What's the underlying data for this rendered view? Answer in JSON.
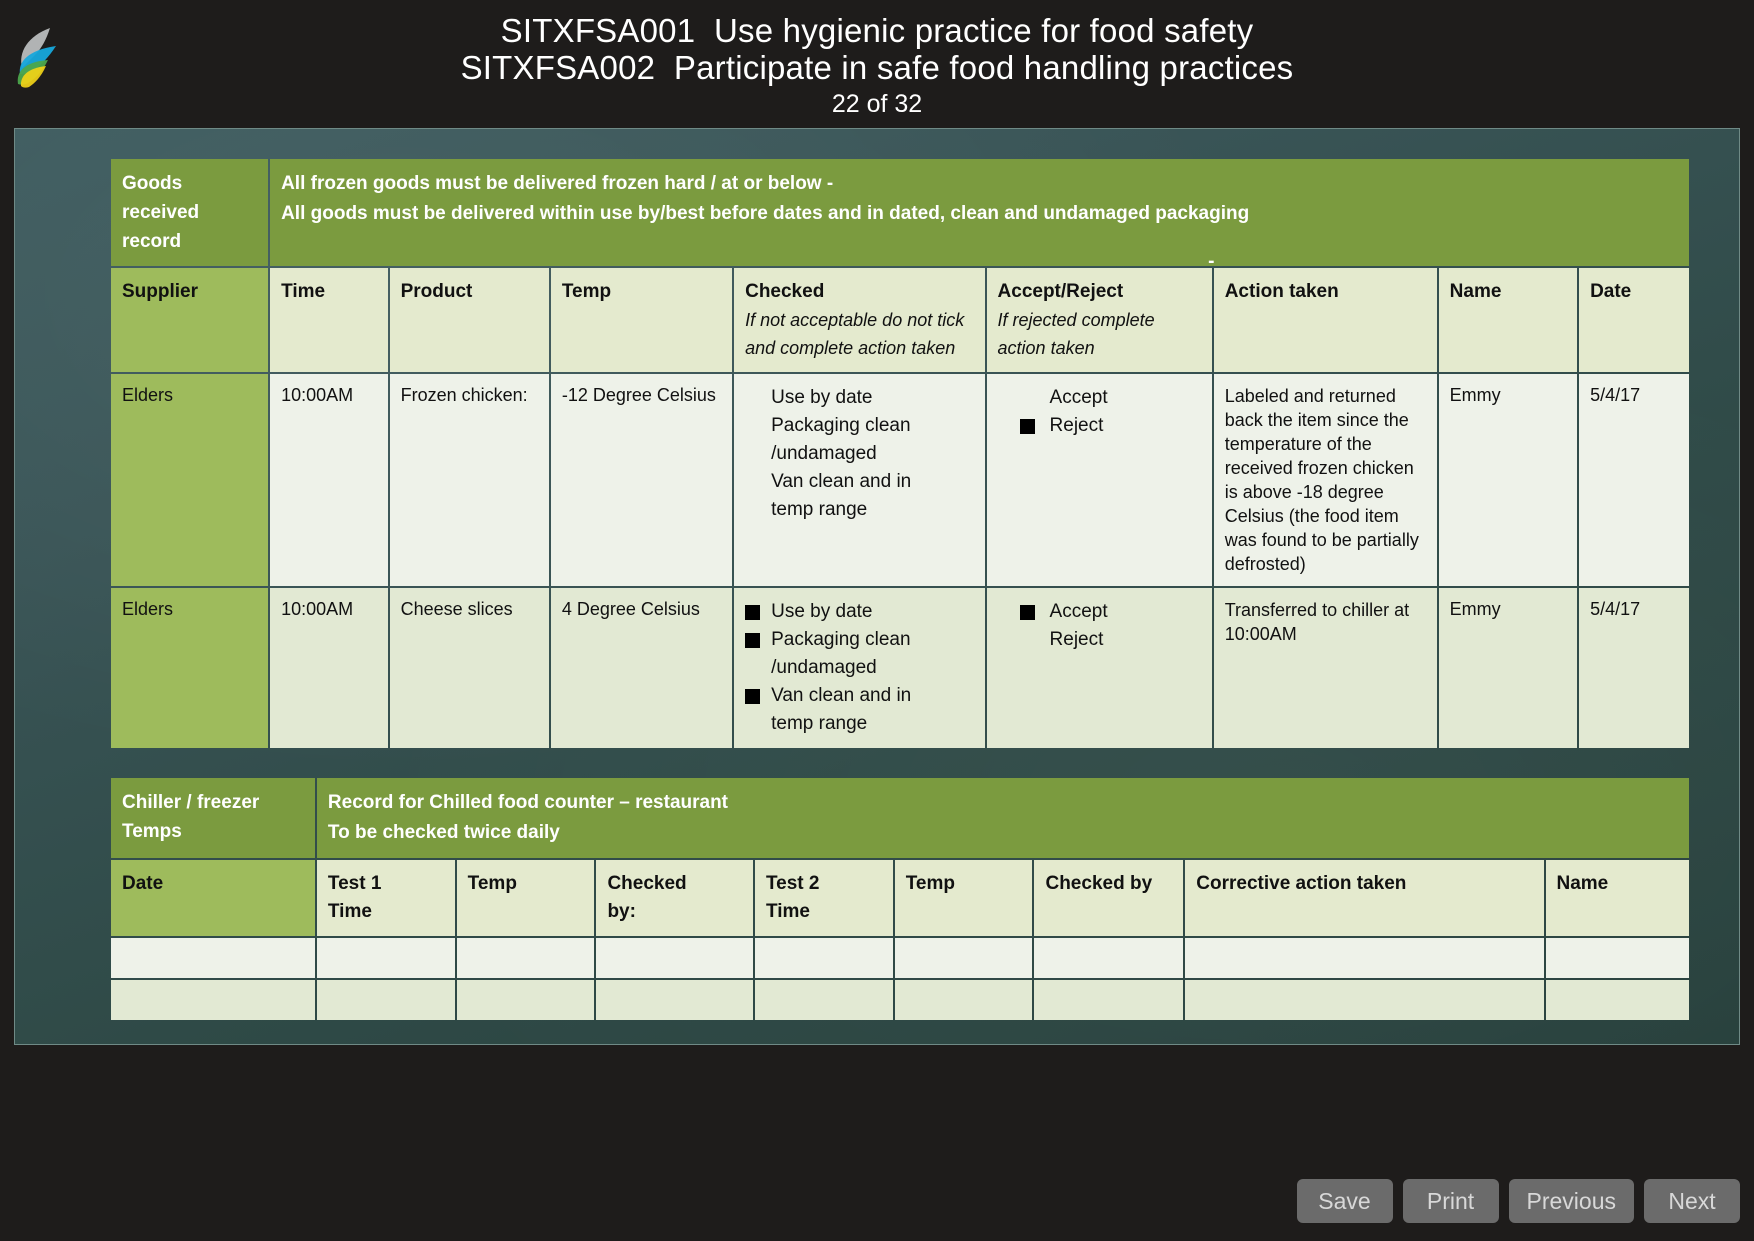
{
  "header": {
    "title_line1": "SITXFSA001  Use hygienic practice for food safety",
    "title_line2": "SITXFSA002  Participate in safe food handling practices",
    "slide_counter": "22 of 32",
    "logo_name": "company-feather-logo"
  },
  "goods_table": {
    "banner_label": "Goods\nreceived\nrecord",
    "banner_line1": "All frozen goods must be delivered frozen hard / at or below -",
    "banner_line2": "All goods must be delivered within use by/best before dates and in dated, clean and undamaged packaging",
    "banner_trailing_dash": "-",
    "columns": [
      {
        "main": "Supplier",
        "sub": ""
      },
      {
        "main": "Time",
        "sub": ""
      },
      {
        "main": "Product",
        "sub": ""
      },
      {
        "main": "Temp",
        "sub": ""
      },
      {
        "main": "Checked",
        "sub": "If not acceptable do not tick and complete action taken"
      },
      {
        "main": "Accept/Reject",
        "sub": "If rejected complete action taken"
      },
      {
        "main": "Action taken",
        "sub": ""
      },
      {
        "main": "Name",
        "sub": ""
      },
      {
        "main": "Date",
        "sub": ""
      }
    ],
    "rows": [
      {
        "supplier": "Elders",
        "time": "10:00AM",
        "product": "Frozen chicken:",
        "temp": "-12 Degree Celsius",
        "checked": [
          {
            "label": "Use by date",
            "ticked": false
          },
          {
            "label": "Packaging clean",
            "ticked": false
          },
          {
            "label": "/undamaged",
            "ticked": false
          },
          {
            "label": "Van clean and in",
            "ticked": false
          },
          {
            "label": "temp range",
            "ticked": false
          }
        ],
        "accept_reject": [
          {
            "label": "Accept",
            "ticked": false
          },
          {
            "label": "Reject",
            "ticked": true
          }
        ],
        "action_taken": "Labeled and returned back the item since the temperature of the received frozen chicken is above -18 degree Celsius (the food item was found to be partially defrosted)",
        "name": "Emmy",
        "date": "5/4/17"
      },
      {
        "supplier": "Elders",
        "time": "10:00AM",
        "product": "Cheese slices",
        "temp": "4 Degree Celsius",
        "checked": [
          {
            "label": "Use by date",
            "ticked": true
          },
          {
            "label": "Packaging clean",
            "ticked": true
          },
          {
            "label": "/undamaged",
            "ticked": false
          },
          {
            "label": "Van clean and in",
            "ticked": true
          },
          {
            "label": "temp range",
            "ticked": false
          }
        ],
        "accept_reject": [
          {
            "label": "Accept",
            "ticked": true
          },
          {
            "label": "Reject",
            "ticked": false
          }
        ],
        "action_taken": "Transferred to chiller at 10:00AM",
        "name": "Emmy",
        "date": "5/4/17"
      }
    ]
  },
  "chiller_table": {
    "banner_label": "Chiller / freezer\nTemps",
    "banner_line1": "Record for Chilled food counter – restaurant",
    "banner_line2": "To be checked twice daily",
    "columns": [
      {
        "main": "Date",
        "sub": ""
      },
      {
        "main": "Test 1",
        "sub": "Time"
      },
      {
        "main": "Temp",
        "sub": ""
      },
      {
        "main": "Checked",
        "sub": "by:"
      },
      {
        "main": "Test 2",
        "sub": "Time"
      },
      {
        "main": "Temp",
        "sub": ""
      },
      {
        "main": "Checked by",
        "sub": ""
      },
      {
        "main": "Corrective action taken",
        "sub": ""
      },
      {
        "main": "Name",
        "sub": ""
      }
    ],
    "empty_rows": 2
  },
  "footer": {
    "buttons": [
      {
        "label": "Save"
      },
      {
        "label": "Print"
      },
      {
        "label": "Previous"
      },
      {
        "label": "Next"
      }
    ]
  },
  "colors": {
    "banner_green": "#7b9b3f",
    "first_col_green": "#9ebb5c",
    "header_cell": "#e4eace",
    "row_light": "#eef2e9",
    "row_dark": "#e2e9d3",
    "chalkboard": "#37534f",
    "app_background": "#1e1c1b",
    "button_grey": "#6b6b6b"
  }
}
